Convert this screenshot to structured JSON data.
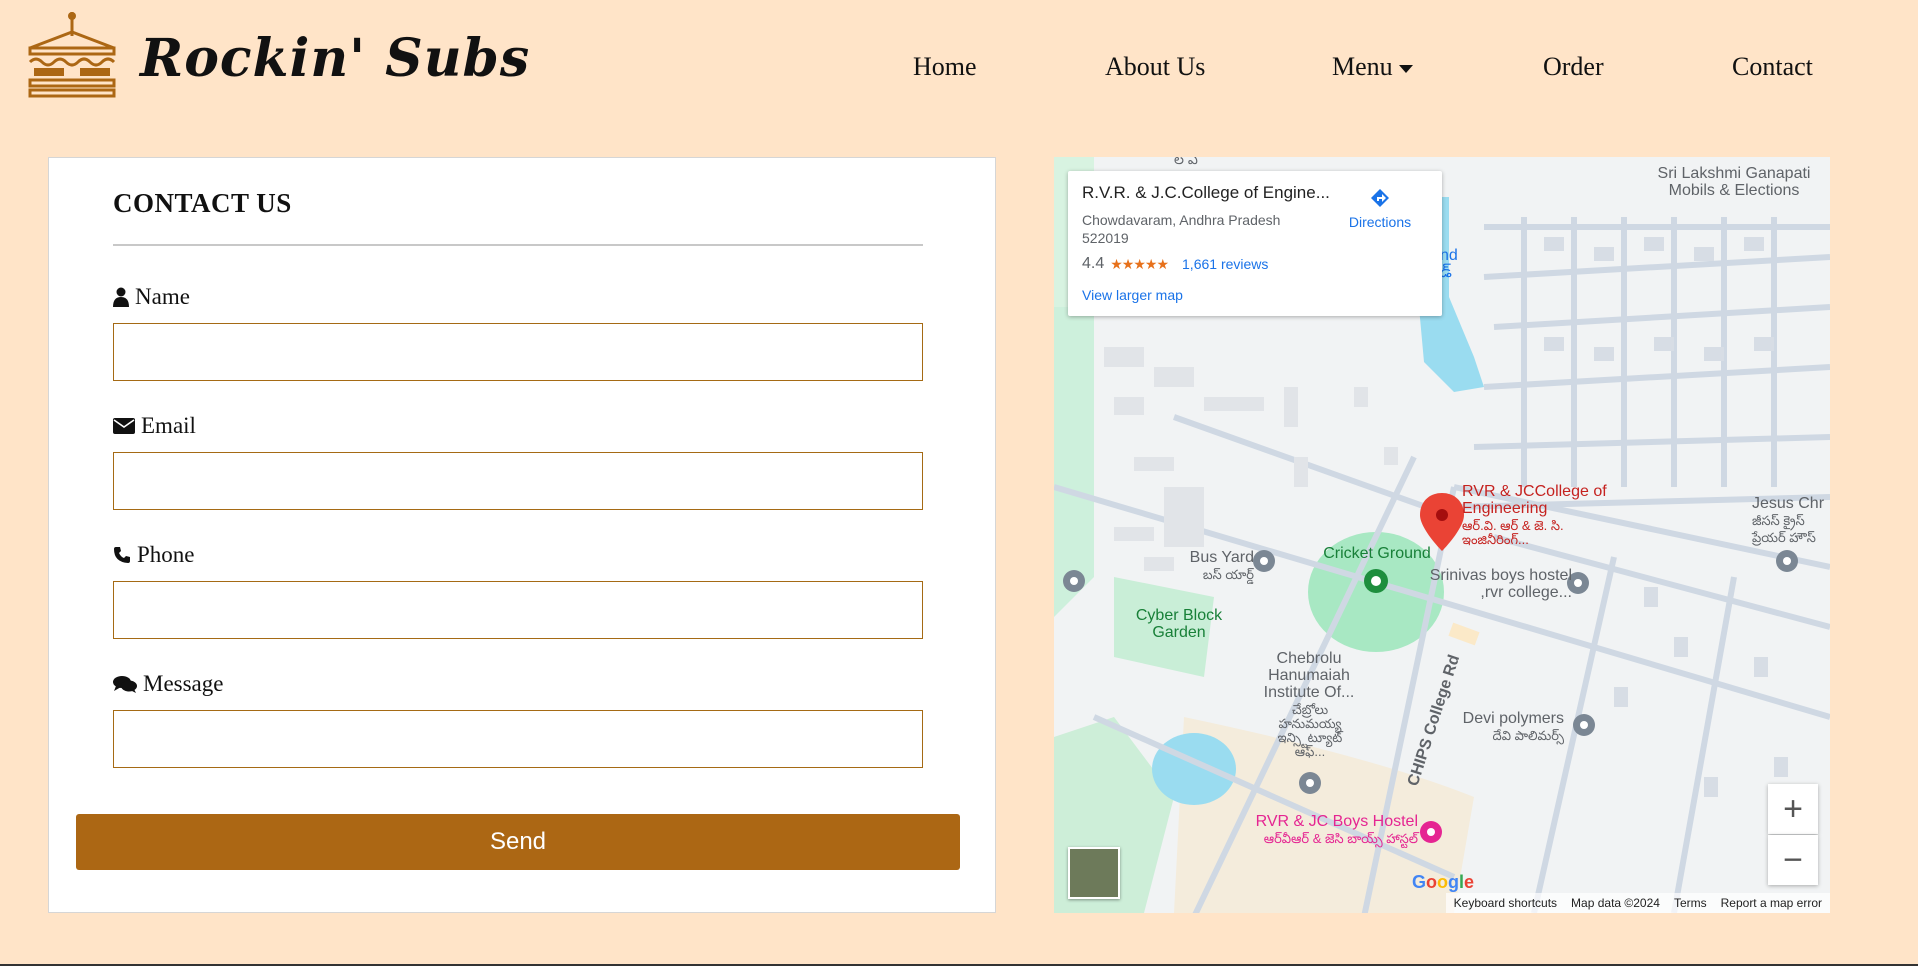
{
  "brand": {
    "name": "Rockin' Subs",
    "logo_icon": "sandwich-icon"
  },
  "nav": {
    "home": "Home",
    "about": "About Us",
    "menu": "Menu",
    "order": "Order",
    "contact": "Contact"
  },
  "contact": {
    "title": "CONTACT US",
    "name_label": "Name",
    "email_label": "Email",
    "phone_label": "Phone",
    "message_label": "Message",
    "name_value": "",
    "email_value": "",
    "phone_value": "",
    "message_value": "",
    "send_label": "Send"
  },
  "map": {
    "place_title": "R.V.R. & J.C.College of Engine...",
    "address": "Chowdavaram, Andhra Pradesh 522019",
    "rating": "4.4",
    "stars": "★★★★★",
    "reviews": "1,661 reviews",
    "view_larger": "View larger map",
    "directions": "Directions",
    "labels": {
      "top_right": "Sri Lakshmi Ganapati Mobils & Elections",
      "pin": "RVR & JCCollege of Engineering",
      "pin_te": "ఆర్.వి. ఆర్ & జె. సి. ఇంజినీరింగ్...",
      "bus_yard": "Bus Yard",
      "bus_yard_te": "బస్ యార్డ్",
      "cricket": "Cricket Ground",
      "srinivas": "Srinivas boys hostel ,rvr college...",
      "cyber": "Cyber Block Garden",
      "chebrolu": "Chebrolu Hanumaiah Institute Of...",
      "chebrolu_te": "చేబ్రోలు హనుమయ్య ఇన్స్టిట్యూట్ ఆఫ్...",
      "road": "CHIPS College Rd",
      "devi": "Devi polymers",
      "devi_te": "దేవి పాలిమర్స్",
      "jesus": "Jesus Chr",
      "jesus_te": "జీసస్ క్రైస్ ప్రేయర్ హౌస్",
      "hostel": "RVR & JC Boys Hostel",
      "hostel_te": "ఆర్‌వీఆర్ & జెసి బాయ్స్ హాస్టల్",
      "top_te": "ల ఏ",
      "left_blue": "nd",
      "left_blue_te": "డ్"
    },
    "zoom_in": "+",
    "zoom_out": "−",
    "google": "Google",
    "attribution": {
      "shortcuts": "Keyboard shortcuts",
      "data": "Map data ©2024",
      "terms": "Terms",
      "report": "Report a map error"
    }
  },
  "colors": {
    "page_bg": "#ffe4c8",
    "accent": "#ac6714",
    "field_border": "#a56a14",
    "map_pin": "#ea4335",
    "link": "#1a73e8"
  }
}
